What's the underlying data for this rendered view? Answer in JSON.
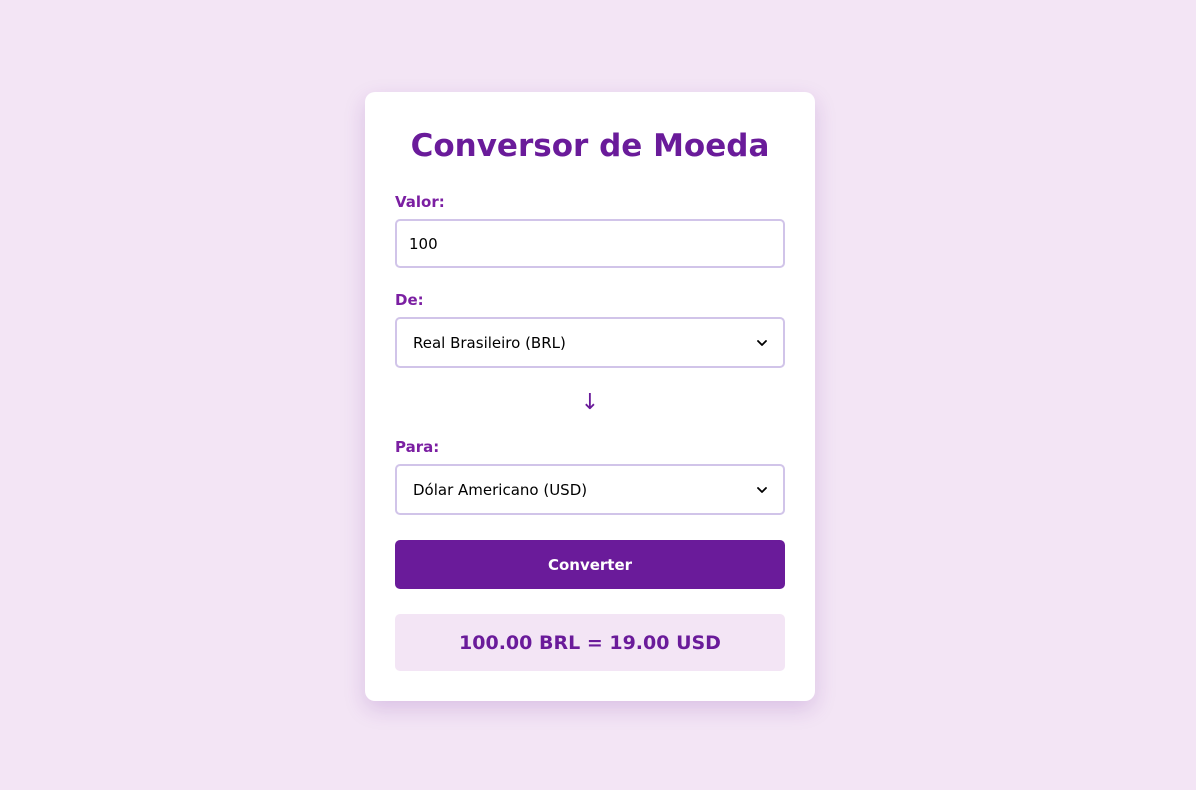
{
  "converter": {
    "title": "Conversor de Moeda",
    "amount": {
      "label": "Valor:",
      "value": "100"
    },
    "from": {
      "label": "De:",
      "selected": "Real Brasileiro (BRL)"
    },
    "swap_arrow": "↓",
    "to": {
      "label": "Para:",
      "selected": "Dólar Americano (USD)"
    },
    "convert_label": "Converter",
    "result": "100.00 BRL = 19.00 USD"
  },
  "colors": {
    "background": "#f3e5f5",
    "accent": "#6a1b9a",
    "label": "#7b1fa2",
    "field_border": "#d1c4e9",
    "result_background": "#f3e5f5"
  }
}
